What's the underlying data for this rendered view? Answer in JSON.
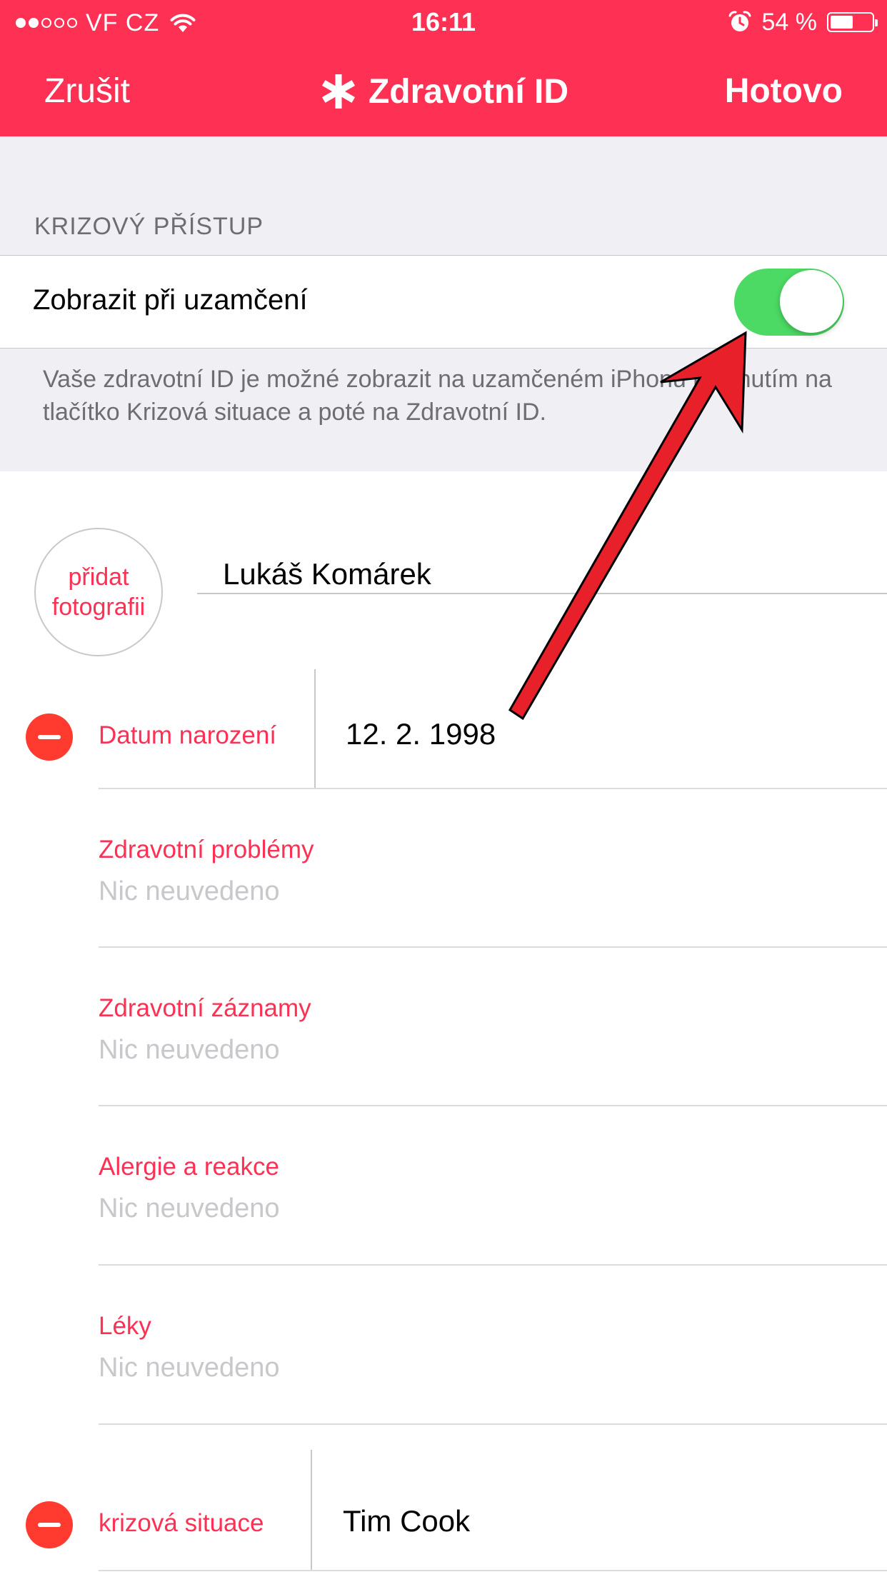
{
  "status_bar": {
    "carrier": "VF CZ",
    "time": "16:11",
    "battery_percent": "54 %",
    "battery_level": 0.54,
    "signal_bars_filled": 2,
    "signal_bars_total": 5
  },
  "nav": {
    "cancel_label": "Zrušit",
    "title": "Zdravotní ID",
    "done_label": "Hotovo",
    "title_icon": "asterisk-icon"
  },
  "emergency_access": {
    "section_header": "KRIZOVÝ PŘÍSTUP",
    "toggle_label": "Zobrazit při uzamčení",
    "toggle_on": true,
    "footer_text": "Vaše zdravotní ID je možné zobrazit na uzamčeném iPhonu klepnutím na tlačítko Krizová situace a poté na Zdravotní ID."
  },
  "profile": {
    "add_photo_line1": "přidat",
    "add_photo_line2": "fotografii",
    "name": "Lukáš Komárek"
  },
  "birth_date": {
    "label": "Datum narození",
    "value": "12. 2. 1998"
  },
  "fields": [
    {
      "title": "Zdravotní problémy",
      "placeholder": "Nic neuvedeno"
    },
    {
      "title": "Zdravotní záznamy",
      "placeholder": "Nic neuvedeno"
    },
    {
      "title": "Alergie a reakce",
      "placeholder": "Nic neuvedeno"
    },
    {
      "title": "Léky",
      "placeholder": "Nic neuvedeno"
    }
  ],
  "emergency_contact": {
    "label": "krizová situace",
    "value": "Tim Cook"
  },
  "colors": {
    "accent": "#fe3054",
    "toggle_on": "#4cd964",
    "delete": "#ff3b30",
    "annotation_arrow": "#e8202a"
  }
}
